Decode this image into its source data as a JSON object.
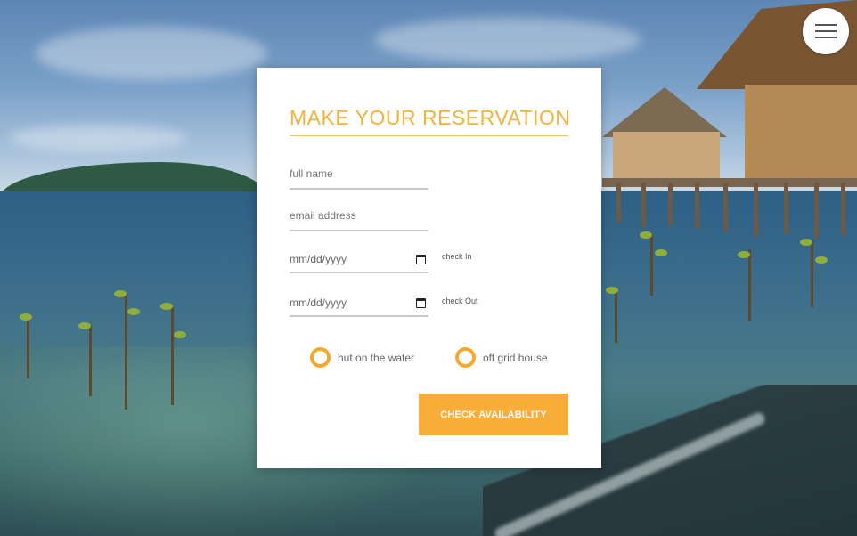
{
  "menu": {
    "icon": "hamburger-menu-icon"
  },
  "form": {
    "title": "MAKE YOUR RESERVATION",
    "full_name_placeholder": "full name",
    "email_placeholder": "email address",
    "check_in": {
      "value": "mm/dd/yyyy",
      "label": "check In",
      "icon": "calendar-icon"
    },
    "check_out": {
      "value": "mm/dd/yyyy",
      "label": "check Out",
      "icon": "calendar-icon"
    },
    "options": [
      {
        "label": "hut on the water"
      },
      {
        "label": "off grid house"
      }
    ],
    "submit_label": "CHECK AVAILABILITY"
  },
  "colors": {
    "accent": "#f2b33d",
    "button": "#f8ad38",
    "radio": "#f2aa2e"
  }
}
